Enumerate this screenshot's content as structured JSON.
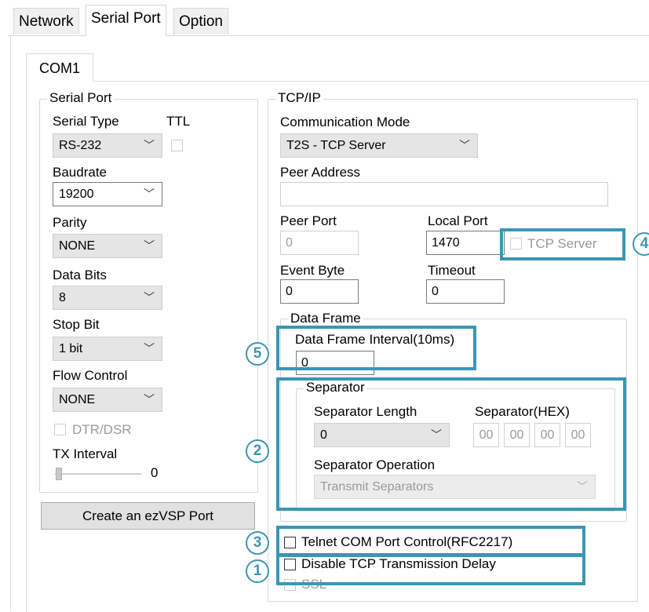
{
  "main_tabs": [
    "Network",
    "Serial Port",
    "Option"
  ],
  "com_tab": "COM1",
  "serial_port": {
    "title": "Serial Port",
    "serial_type_label": "Serial Type",
    "serial_type_value": "RS-232",
    "ttl_label": "TTL",
    "baudrate_label": "Baudrate",
    "baudrate_value": "19200",
    "parity_label": "Parity",
    "parity_value": "NONE",
    "data_bits_label": "Data Bits",
    "data_bits_value": "8",
    "stop_bit_label": "Stop Bit",
    "stop_bit_value": "1 bit",
    "flow_control_label": "Flow Control",
    "flow_control_value": "NONE",
    "dtr_dsr_label": "DTR/DSR",
    "tx_interval_label": "TX Interval",
    "tx_interval_value": "0",
    "create_button": "Create an ezVSP Port"
  },
  "tcpip": {
    "title": "TCP/IP",
    "comm_mode_label": "Communication Mode",
    "comm_mode_value": "T2S - TCP Server",
    "peer_address_label": "Peer Address",
    "peer_address_value": "",
    "peer_port_label": "Peer Port",
    "peer_port_value": "0",
    "local_port_label": "Local Port",
    "local_port_value": "1470",
    "tcp_server_label": "TCP Server",
    "event_byte_label": "Event Byte",
    "event_byte_value": "0",
    "timeout_label": "Timeout",
    "timeout_value": "0"
  },
  "data_frame": {
    "title": "Data Frame",
    "interval_label": "Data Frame Interval(10ms)",
    "interval_value": "0"
  },
  "separator": {
    "title": "Separator",
    "length_label": "Separator Length",
    "length_value": "0",
    "hex_label": "Separator(HEX)",
    "hex_values": [
      "00",
      "00",
      "00",
      "00"
    ],
    "operation_label": "Separator Operation",
    "operation_value": "Transmit Separators"
  },
  "options": {
    "telnet_label": "Telnet COM Port Control(RFC2217)",
    "disable_delay_label": "Disable TCP Transmission Delay",
    "ssl_label": "SSL"
  },
  "annotations": {
    "n1": "1",
    "n2": "2",
    "n3": "3",
    "n4": "4",
    "n5": "5",
    "color": "#3a96b4"
  }
}
